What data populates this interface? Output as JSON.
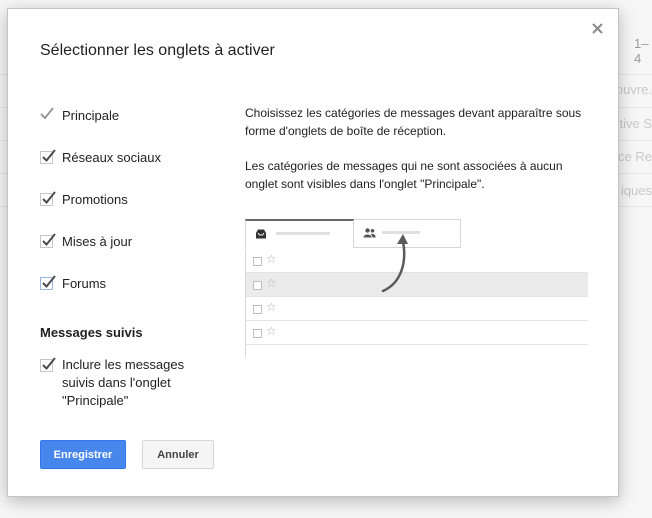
{
  "background": {
    "count": "1–4",
    "right_snippets": [
      "ouvre.",
      "tive S",
      "ce Re",
      "iques"
    ]
  },
  "dialog": {
    "title": "Sélectionner les onglets à activer",
    "categories": [
      {
        "label": "Principale",
        "checked": true,
        "disabled": true
      },
      {
        "label": "Réseaux sociaux",
        "checked": true
      },
      {
        "label": "Promotions",
        "checked": true
      },
      {
        "label": "Mises à jour",
        "checked": true
      },
      {
        "label": "Forums",
        "checked": true
      }
    ],
    "starred_section": {
      "heading": "Messages suivis",
      "include_label": "Inclure les messages suivis dans l'onglet \"Principale\"",
      "checked": true
    },
    "description": [
      "Choisissez les catégories de messages devant apparaître sous forme d'onglets de boîte de réception.",
      "Les catégories de messages qui ne sont associées à aucun onglet sont visibles dans l'onglet \"Principale\"."
    ],
    "preview": {
      "star_glyph": "☆",
      "rows": 4,
      "selected_row": 1
    },
    "buttons": {
      "save": "Enregistrer",
      "cancel": "Annuler"
    },
    "colors": {
      "primary": "#4787ed",
      "check": "#4b4b4b"
    }
  }
}
